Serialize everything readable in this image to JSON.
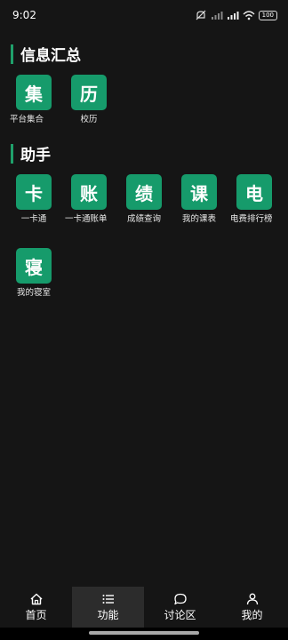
{
  "status_bar": {
    "time": "9:02",
    "battery": "100"
  },
  "sections": [
    {
      "title": "信息汇总",
      "tiles": [
        {
          "glyph": "集",
          "label": "平台集合"
        },
        {
          "glyph": "历",
          "label": "校历"
        }
      ]
    },
    {
      "title": "助手",
      "tiles": [
        {
          "glyph": "卡",
          "label": "一卡通"
        },
        {
          "glyph": "账",
          "label": "一卡通账单"
        },
        {
          "glyph": "绩",
          "label": "成绩查询"
        },
        {
          "glyph": "课",
          "label": "我的课表"
        },
        {
          "glyph": "电",
          "label": "电费排行榜"
        },
        {
          "glyph": "寝",
          "label": "我的寝室"
        }
      ]
    }
  ],
  "bottom_nav": [
    {
      "label": "首页",
      "icon": "home-icon",
      "active": false
    },
    {
      "label": "功能",
      "icon": "list-icon",
      "active": true
    },
    {
      "label": "讨论区",
      "icon": "chat-icon",
      "active": false
    },
    {
      "label": "我的",
      "icon": "person-icon",
      "active": false
    }
  ],
  "colors": {
    "accent": "#169b6b",
    "section_bar": "#1fa06b",
    "background": "#151515",
    "active_tab": "#2c2c2c"
  }
}
